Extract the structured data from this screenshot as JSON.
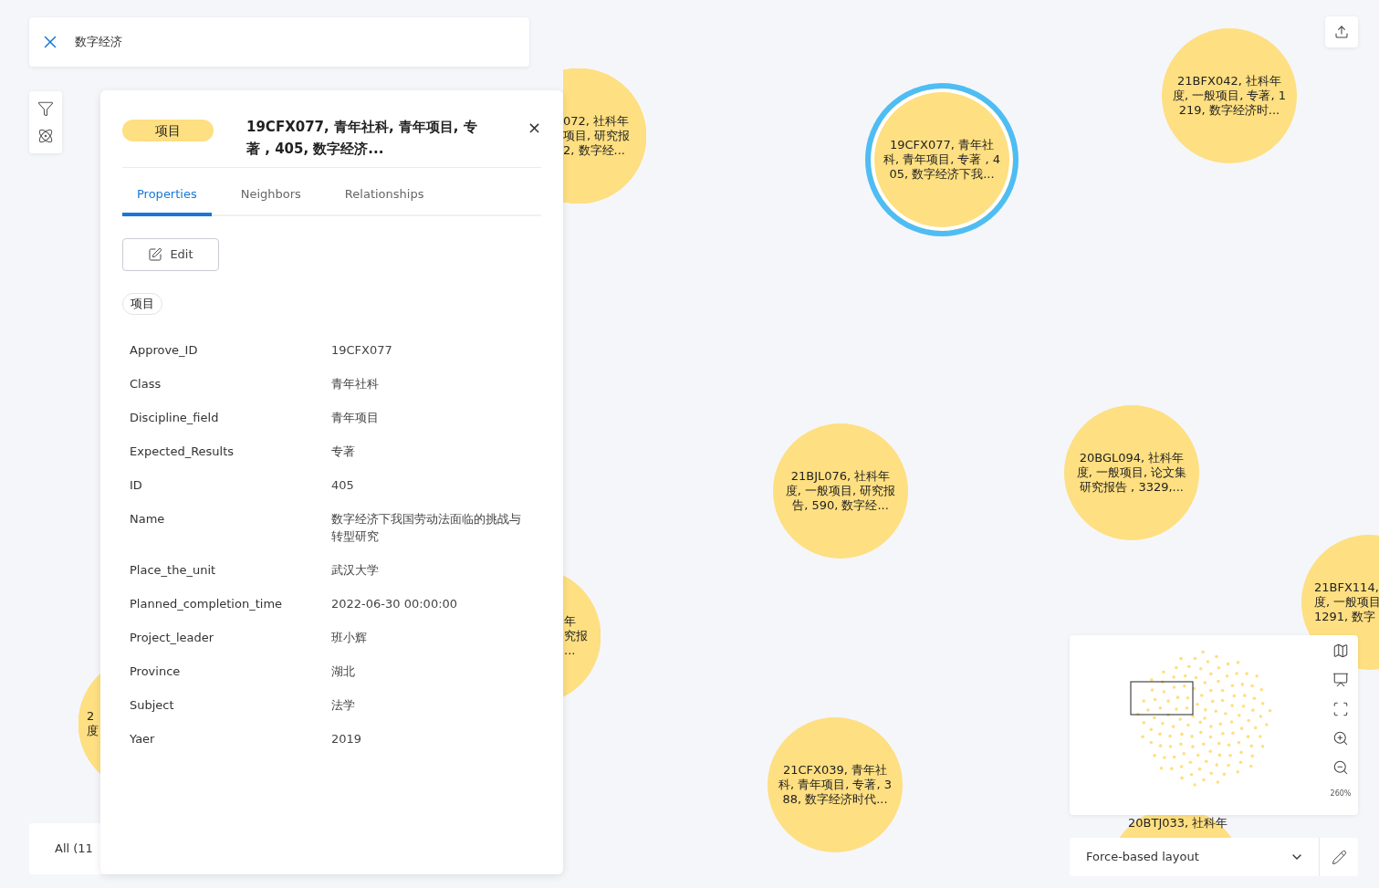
{
  "search": {
    "value": "数字经济"
  },
  "nodes": [
    {
      "lines": [
        "072, 社科年",
        "项目, 研究报",
        "2, 数字经..."
      ],
      "selected": false
    },
    {
      "lines": [
        "19CFX077, 青年社",
        "科, 青年项目, 专著 , 4",
        "05, 数字经济下我..."
      ],
      "selected": true
    },
    {
      "lines": [
        "21BFX042, 社科年",
        "度, 一般项目, 专著, 1",
        "219, 数字经济时..."
      ],
      "selected": false
    },
    {
      "lines": [
        "21BJL076, 社科年",
        "度, 一般项目, 研究报",
        "告, 590, 数字经..."
      ],
      "selected": false
    },
    {
      "lines": [
        "20BGL094, 社科年",
        "度, 一般项目, 论文集",
        "研究报告 , 3329,..."
      ],
      "selected": false
    },
    {
      "lines": [
        "21BFX114,",
        "度, 一般项目",
        "1291, 数字"
      ],
      "selected": false
    },
    {
      "lines": [
        "年",
        "究报",
        "..."
      ],
      "selected": false
    },
    {
      "lines": [
        "2",
        "度"
      ],
      "selected": false
    },
    {
      "lines": [
        "21CFX039, 青年社",
        "科, 青年项目, 专著, 3",
        "88, 数字经济时代..."
      ],
      "selected": false
    },
    {
      "lines": [
        "20BTJ033, 社科年"
      ],
      "selected": false
    }
  ],
  "panel": {
    "badge": "项目",
    "title": "19CFX077, 青年社科, 青年项目, 专著 , 405, 数字经济...",
    "close": "×",
    "tabs": [
      {
        "label": "Properties",
        "selected": true
      },
      {
        "label": "Neighbors",
        "selected": false
      },
      {
        "label": "Relationships",
        "selected": false
      }
    ],
    "edit_button": "Edit",
    "label_chip": "项目",
    "properties": [
      {
        "key": "Approve_ID",
        "value": "19CFX077"
      },
      {
        "key": "Class",
        "value": "青年社科"
      },
      {
        "key": "Discipline_field",
        "value": "青年项目"
      },
      {
        "key": "Expected_Results",
        "value": "专著"
      },
      {
        "key": "ID",
        "value": "405"
      },
      {
        "key": "Name",
        "value": "数字经济下我国劳动法面临的挑战与转型研究"
      },
      {
        "key": "Place_the_unit",
        "value": "武汉大学"
      },
      {
        "key": "Planned_completion_time",
        "value": "2022-06-30 00:00:00"
      },
      {
        "key": "Project_leader",
        "value": "班小辉"
      },
      {
        "key": "Province",
        "value": "湖北"
      },
      {
        "key": "Subject",
        "value": "法学"
      },
      {
        "key": "Yaer",
        "value": "2019"
      }
    ]
  },
  "legend": {
    "label": "All (11"
  },
  "minimap": {
    "zoom": "260%"
  },
  "layout": {
    "value": "Force-based layout"
  }
}
